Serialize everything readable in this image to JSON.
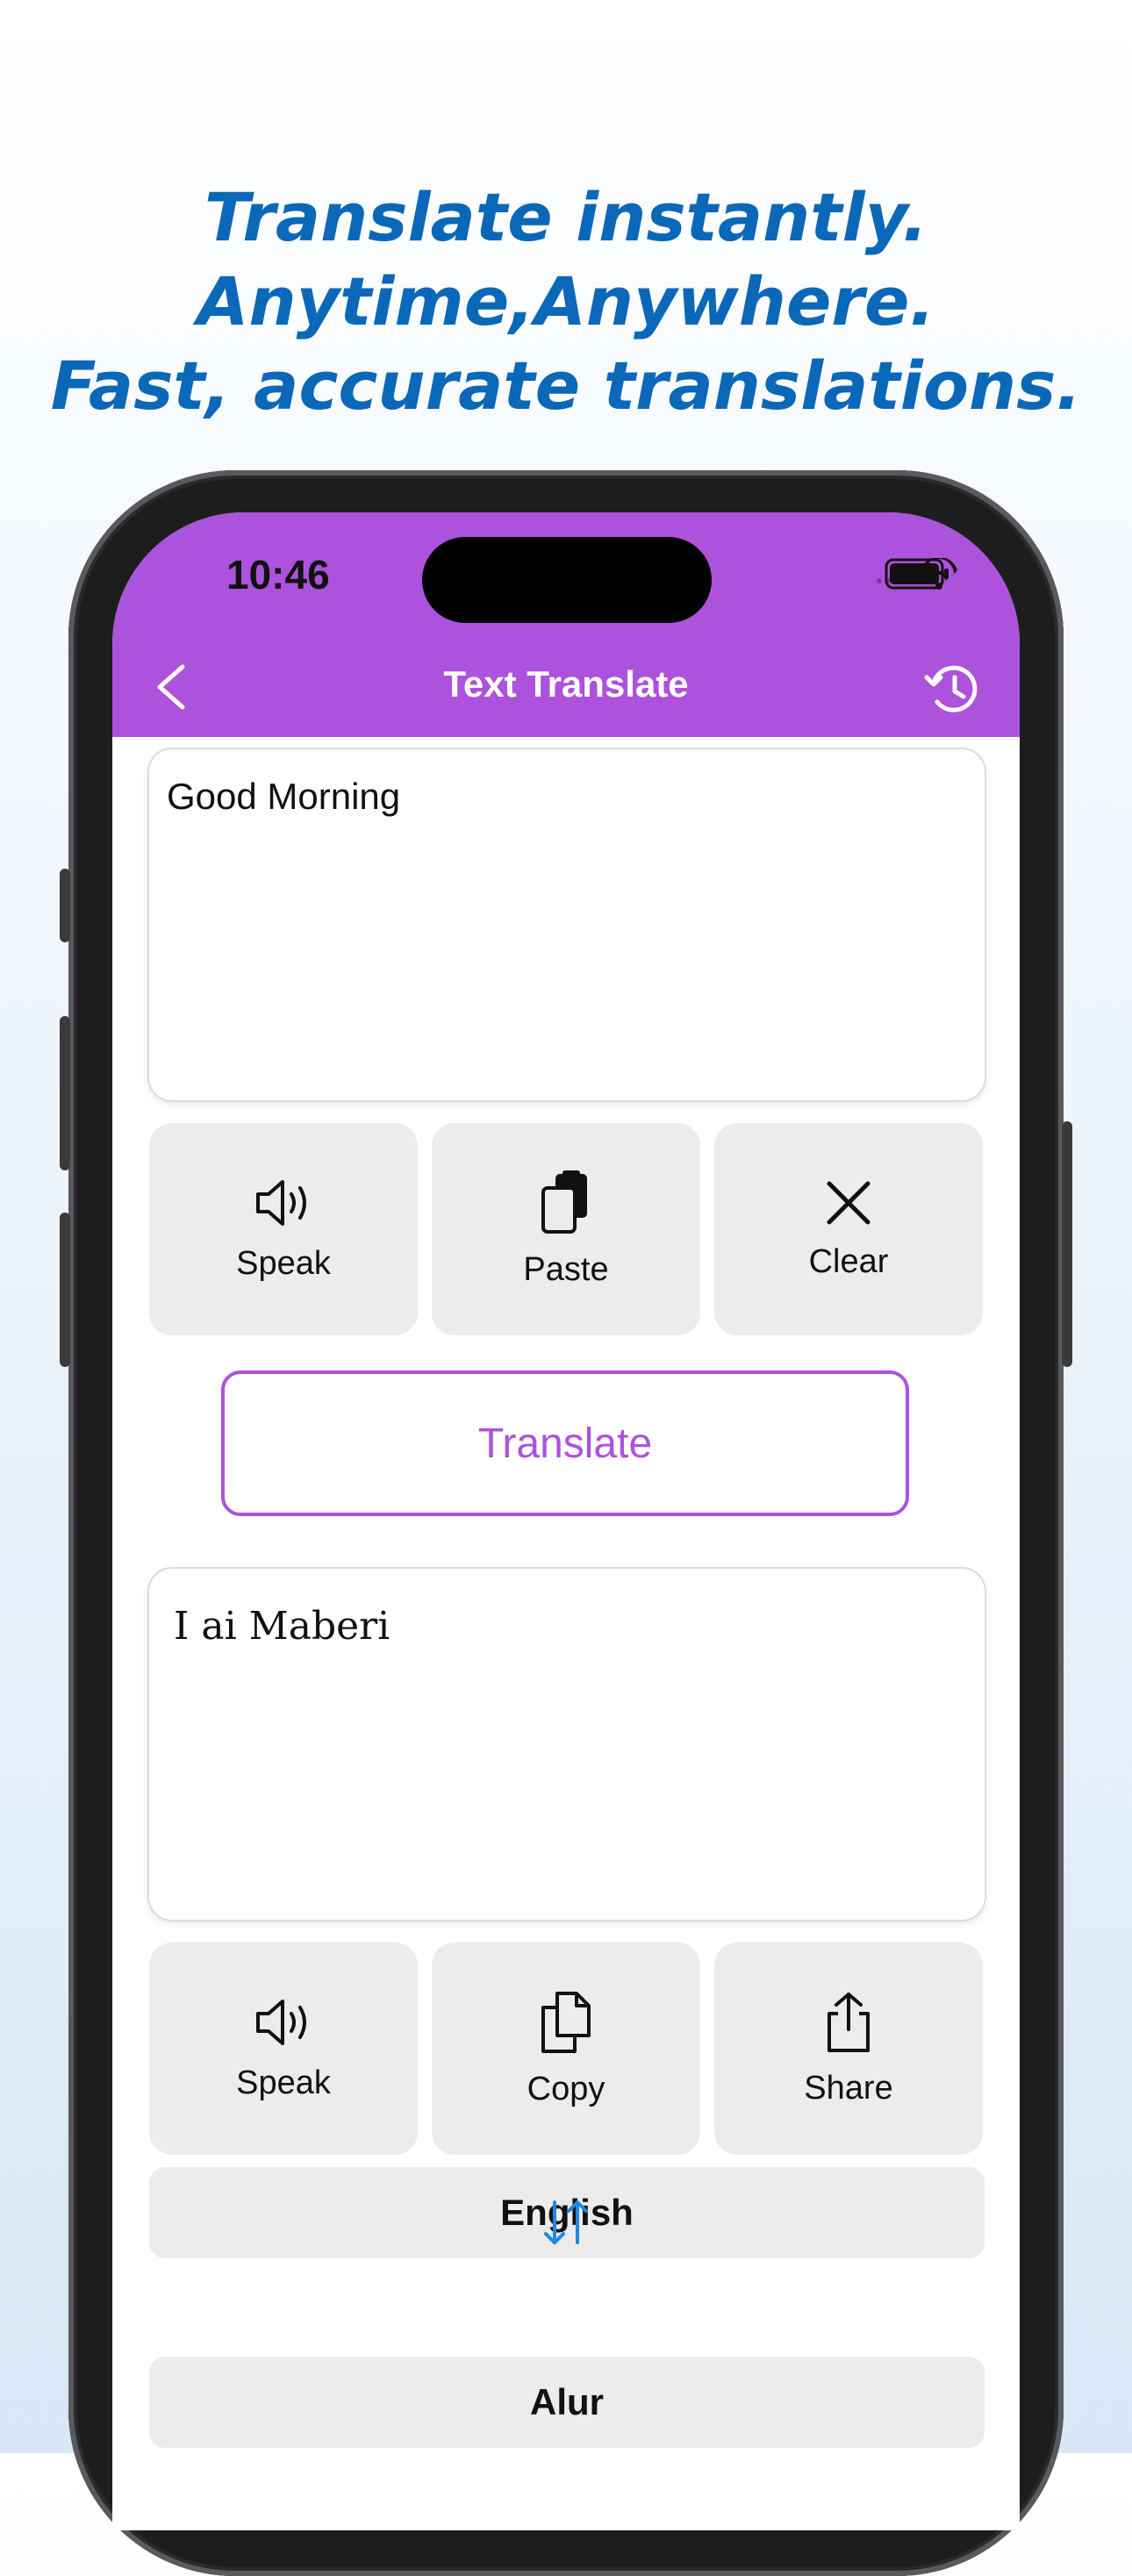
{
  "headline": {
    "line1": "Translate instantly.",
    "line2": "Anytime,Anywhere.",
    "line3": "Fast, accurate translations."
  },
  "status_bar": {
    "time": "10:46",
    "icons": [
      "wifi-icon",
      "battery-icon"
    ]
  },
  "nav": {
    "title": "Text Translate",
    "back_icon": "chevron-left-icon",
    "history_icon": "history-icon"
  },
  "input": {
    "value": "Good Morning",
    "actions": [
      {
        "label": "Speak",
        "icon": "speaker-icon"
      },
      {
        "label": "Paste",
        "icon": "paste-icon"
      },
      {
        "label": "Clear",
        "icon": "close-icon"
      }
    ]
  },
  "translate_button": "Translate",
  "output": {
    "value": "I ai Maberi",
    "actions": [
      {
        "label": "Speak",
        "icon": "speaker-icon"
      },
      {
        "label": "Copy",
        "icon": "copy-icon"
      },
      {
        "label": "Share",
        "icon": "share-icon"
      }
    ]
  },
  "languages": {
    "source": "English",
    "target": "Alur",
    "swap_icon": "swap-arrows-icon"
  },
  "colors": {
    "accent": "#ad52dd",
    "headline": "#0b68b8",
    "swap": "#1e88e5"
  }
}
